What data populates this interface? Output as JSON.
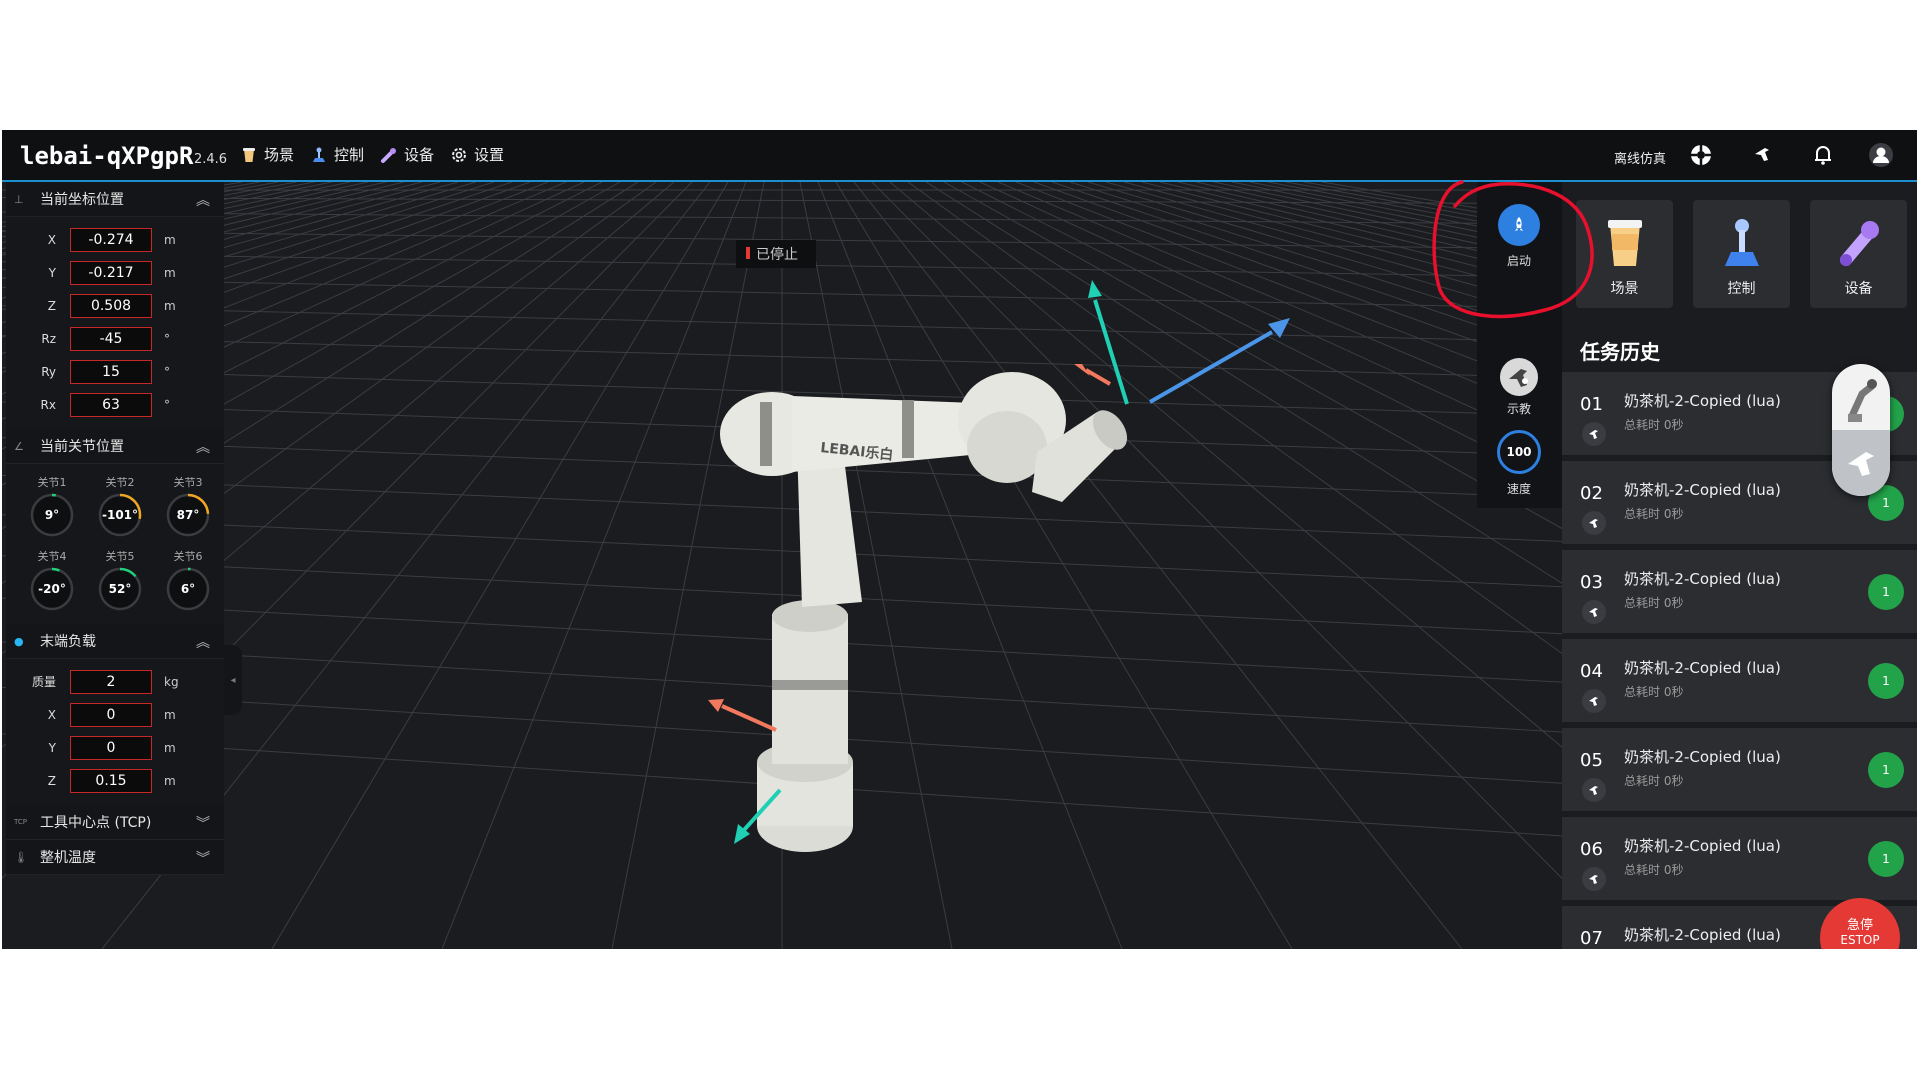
{
  "app": {
    "title": "lebai-qXPgpR",
    "version": "2.4.6"
  },
  "nav": [
    {
      "label": "场景",
      "icon": "cup-icon"
    },
    {
      "label": "控制",
      "icon": "joystick-icon"
    },
    {
      "label": "设备",
      "icon": "wrench-icon"
    },
    {
      "label": "设置",
      "icon": "gear-icon"
    }
  ],
  "topright": {
    "mode": "离线仿真"
  },
  "viewport": {
    "status": "已停止"
  },
  "left": {
    "tcp_title": "当前坐标位置",
    "tcp": [
      {
        "k": "X",
        "v": "-0.274",
        "u": "m"
      },
      {
        "k": "Y",
        "v": "-0.217",
        "u": "m"
      },
      {
        "k": "Z",
        "v": "0.508",
        "u": "m"
      },
      {
        "k": "Rz",
        "v": "-45",
        "u": "°"
      },
      {
        "k": "Ry",
        "v": "15",
        "u": "°"
      },
      {
        "k": "Rx",
        "v": "63",
        "u": "°"
      }
    ],
    "joint_title": "当前关节位置",
    "joints": [
      {
        "label": "关节1",
        "value": "9°",
        "fraction": 0.03
      },
      {
        "label": "关节2",
        "value": "-101°",
        "fraction": 0.28
      },
      {
        "label": "关节3",
        "value": "87°",
        "fraction": 0.24
      },
      {
        "label": "关节4",
        "value": "-20°",
        "fraction": 0.06
      },
      {
        "label": "关节5",
        "value": "52°",
        "fraction": 0.14
      },
      {
        "label": "关节6",
        "value": "6°",
        "fraction": 0.02
      }
    ],
    "payload_title": "末端负载",
    "payload": [
      {
        "k": "质量",
        "v": "2",
        "u": "kg"
      },
      {
        "k": "X",
        "v": "0",
        "u": "m"
      },
      {
        "k": "Y",
        "v": "0",
        "u": "m"
      },
      {
        "k": "Z",
        "v": "0.15",
        "u": "m"
      }
    ],
    "tcp_center_title": "工具中心点 (TCP)",
    "temp_title": "整机温度"
  },
  "tools": {
    "start": "启动",
    "teach": "示教",
    "speed_value": "100",
    "speed_label": "速度"
  },
  "quick": [
    {
      "label": "场景"
    },
    {
      "label": "控制"
    },
    {
      "label": "设备"
    }
  ],
  "history": {
    "title": "任务历史",
    "items": [
      {
        "no": "01",
        "name": "奶茶机-2-Copied (lua)",
        "sub": "总耗时 0秒",
        "count": "1"
      },
      {
        "no": "02",
        "name": "奶茶机-2-Copied (lua)",
        "sub": "总耗时 0秒",
        "count": "1"
      },
      {
        "no": "03",
        "name": "奶茶机-2-Copied (lua)",
        "sub": "总耗时 0秒",
        "count": "1"
      },
      {
        "no": "04",
        "name": "奶茶机-2-Copied (lua)",
        "sub": "总耗时 0秒",
        "count": "1"
      },
      {
        "no": "05",
        "name": "奶茶机-2-Copied (lua)",
        "sub": "总耗时 0秒",
        "count": "1"
      },
      {
        "no": "06",
        "name": "奶茶机-2-Copied (lua)",
        "sub": "总耗时 0秒",
        "count": "1"
      },
      {
        "no": "07",
        "name": "奶茶机-2-Copied (lua)",
        "sub": "",
        "count": ""
      }
    ]
  },
  "estop": {
    "line1": "急停",
    "line2": "ESTOP"
  },
  "robot": {
    "brand": "LEBAI乐白"
  },
  "colors": {
    "accent": "#2d7fe0",
    "alert": "#e53935",
    "success": "#22a34a",
    "annotation": "#e8102c"
  }
}
